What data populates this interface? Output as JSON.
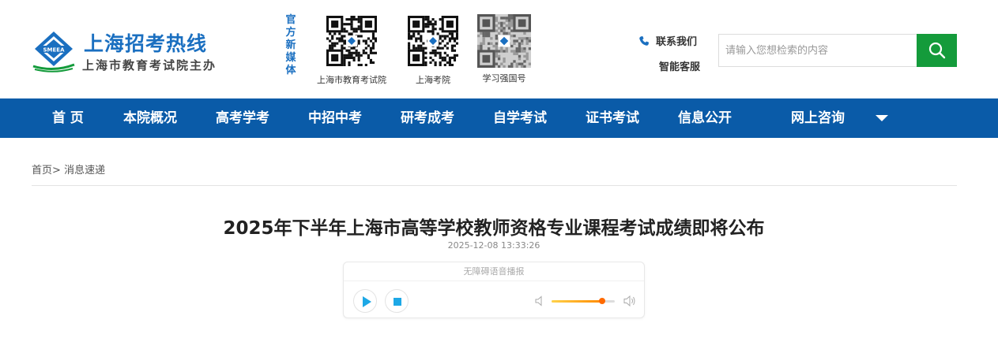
{
  "header": {
    "logo_title": "上海招考热线",
    "logo_subtitle": "上海市教育考试院主办",
    "logo_emblem_text": "SMEEA",
    "media_label": [
      "官",
      "方",
      "新",
      "媒",
      "体"
    ],
    "qr_codes": [
      {
        "caption": "上海市教育考试院"
      },
      {
        "caption": "上海考院"
      },
      {
        "caption": "学习强国号"
      }
    ],
    "contact_label": "联系我们",
    "smart_service_label": "智能客服",
    "search": {
      "placeholder": "请输入您想检索的内容",
      "value": ""
    }
  },
  "nav": {
    "items": [
      "首 页",
      "本院概况",
      "高考学考",
      "中招中考",
      "研考成考",
      "自学考试",
      "证书考试",
      "信息公开",
      "网上咨询"
    ]
  },
  "breadcrumb": {
    "home": "首页",
    "separator": ">",
    "current": "消息速递"
  },
  "article": {
    "title": "2025年下半年上海市高等学校教师资格专业课程考试成绩即将公布",
    "date": "2025-12-08 13:33:26"
  },
  "player": {
    "header": "无障碍语音播报",
    "volume_level": 0.8
  },
  "colors": {
    "brand_blue": "#1a6fc0",
    "nav_bg": "#0a5ba8",
    "search_button": "#149b3b",
    "slider_accent": "#ff8a00"
  },
  "icons": {
    "contact": "phone-icon",
    "search": "search-icon",
    "nav_more": "chevron-down-icon",
    "play": "play-icon",
    "stop": "stop-icon",
    "volume_low": "volume-low-icon",
    "volume_high": "volume-high-icon"
  }
}
